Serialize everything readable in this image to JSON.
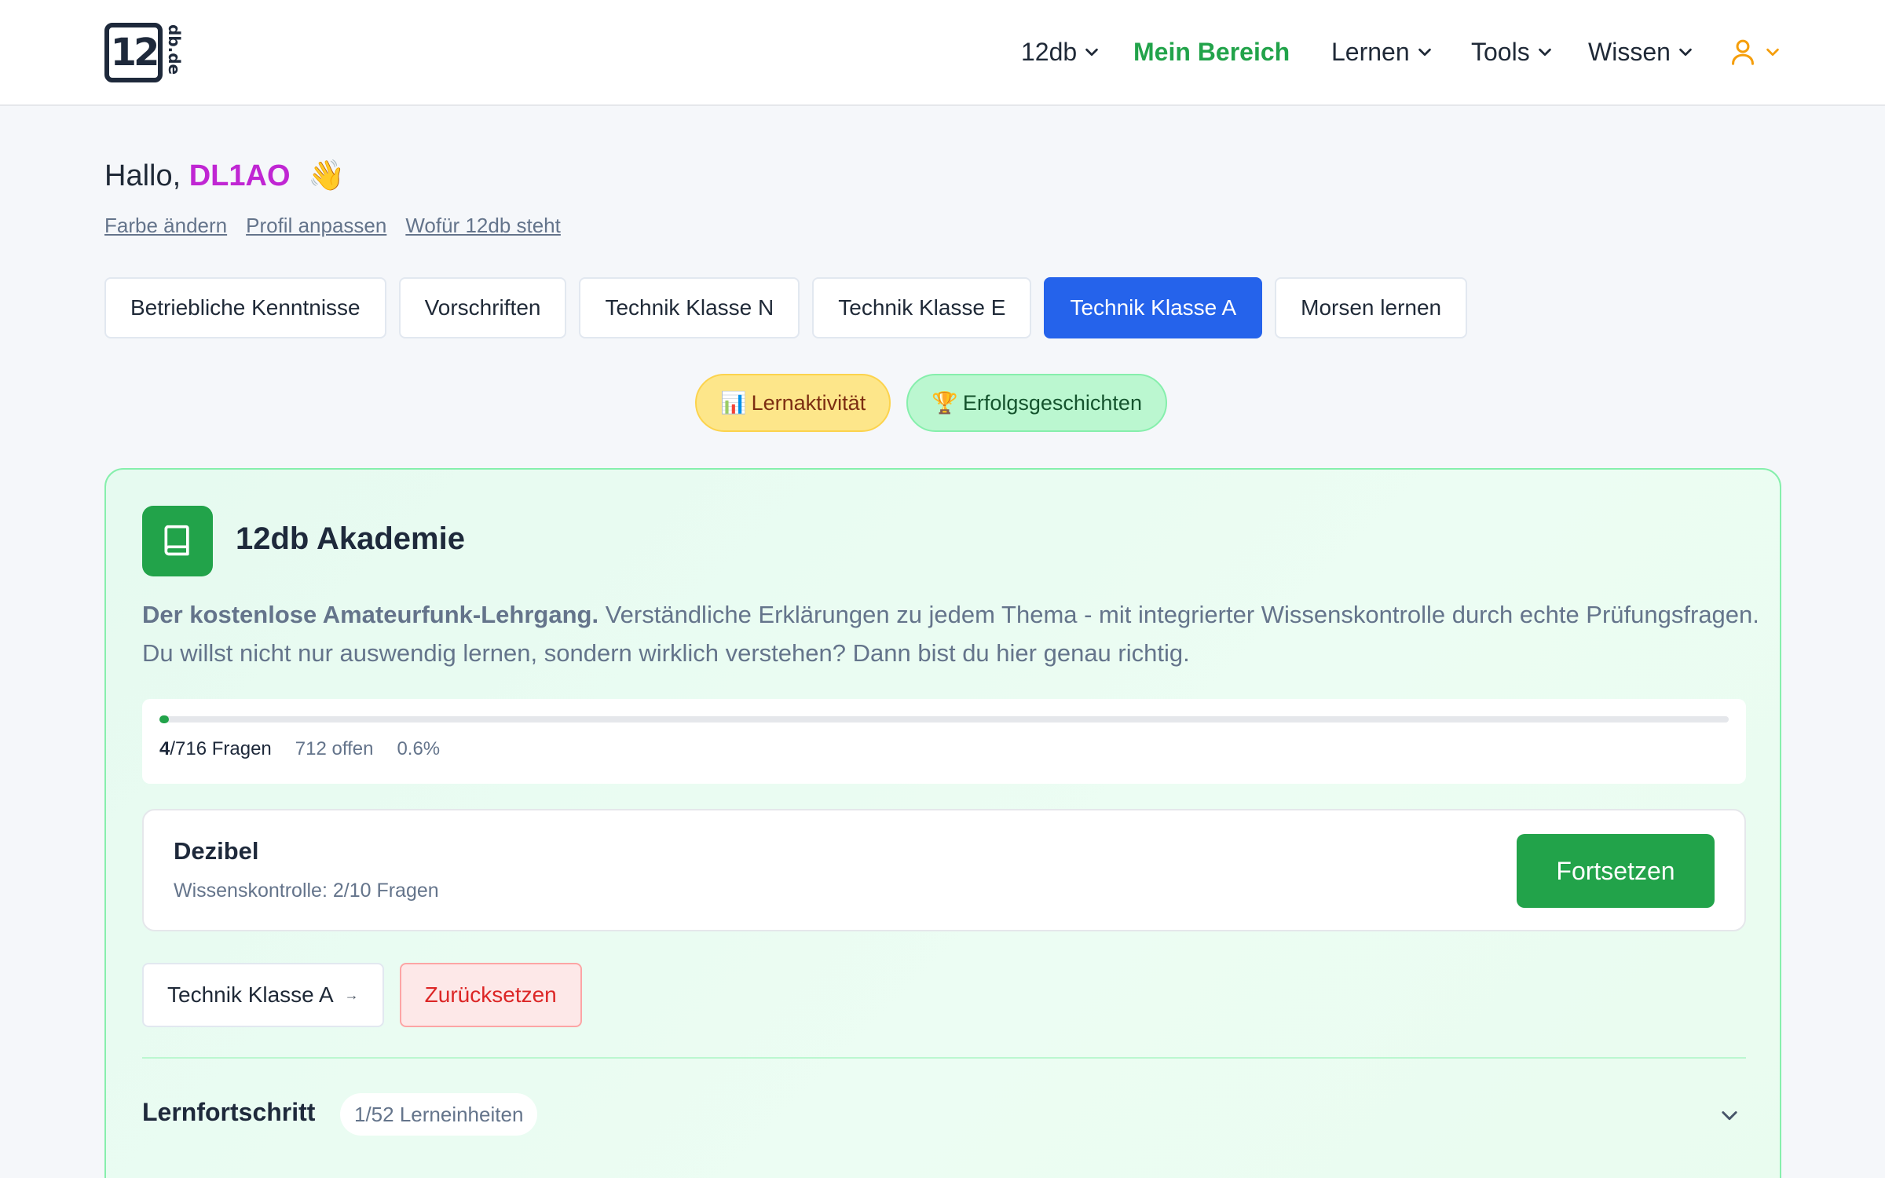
{
  "header": {
    "logo": {
      "main": "12",
      "side": "db.de"
    },
    "nav": [
      {
        "label": "12db",
        "has_dropdown": true
      },
      {
        "label": "Mein Bereich",
        "active": true
      },
      {
        "label": "Lernen",
        "has_dropdown": true
      },
      {
        "label": "Tools",
        "has_dropdown": true
      },
      {
        "label": "Wissen",
        "has_dropdown": true
      }
    ],
    "user_icon": "user-icon",
    "accent_color": "#f59e0b"
  },
  "greeting": {
    "prefix": "Hallo, ",
    "name": "DL1AO",
    "emoji": "👋"
  },
  "links": [
    "Farbe ändern",
    "Profil anpassen",
    "Wofür 12db steht"
  ],
  "tabs": [
    {
      "label": "Betriebliche Kenntnisse"
    },
    {
      "label": "Vorschriften"
    },
    {
      "label": "Technik Klasse N"
    },
    {
      "label": "Technik Klasse E"
    },
    {
      "label": "Technik Klasse A",
      "active": true
    },
    {
      "label": "Morsen lernen"
    }
  ],
  "pills": [
    {
      "emoji": "📊",
      "label": "Lernaktivität"
    },
    {
      "emoji": "🏆",
      "label": "Erfolgsgeschichten"
    }
  ],
  "card": {
    "icon": "book-icon",
    "title": "12db Akademie",
    "desc_bold": "Der kostenlose Amateurfunk-Lehrgang.",
    "desc_rest": " Verständliche Erklärungen zu jedem Thema - mit integrierter Wissenskontrolle durch echte Prüfungsfragen. Du willst nicht nur auswendig lernen, sondern wirklich verstehen? Dann bist du hier genau richtig.",
    "progress": {
      "done": "4",
      "total_label": "/716 Fragen",
      "open_label": "712 offen",
      "percent_label": "0.6%",
      "fraction": 0.006
    },
    "lesson": {
      "title": "Dezibel",
      "subtitle": "Wissenskontrolle: 2/10 Fragen",
      "button": "Fortsetzen"
    },
    "buttons": {
      "course": "Technik Klasse A",
      "course_arrow": "→",
      "reset": "Zurücksetzen"
    },
    "lernfortschritt": {
      "title": "Lernfortschritt",
      "badge": "1/52 Lerneinheiten"
    }
  },
  "colors": {
    "brand_green": "#22a34a",
    "active_tab": "#2563eb",
    "username": "#c026d3",
    "danger": "#dc2626"
  }
}
